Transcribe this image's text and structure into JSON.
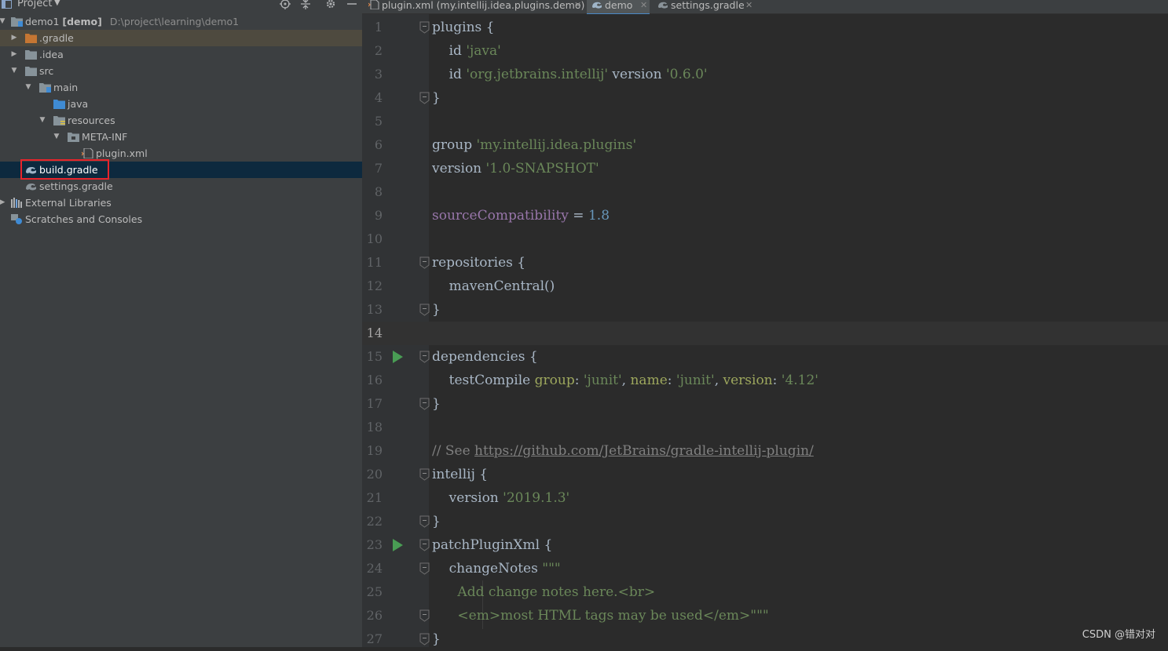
{
  "panel": {
    "title": "Project",
    "tools": [
      "locate-icon",
      "collapse-all-icon",
      "settings-icon",
      "hide-icon"
    ]
  },
  "tree": [
    {
      "label": "demo1",
      "bold": "[demo]",
      "path": "D:\\project\\learning\\demo1",
      "icon": "module-folder-icon",
      "expanded": true
    },
    {
      "label": ".gradle",
      "icon": "folder-orange-icon",
      "expanded": false
    },
    {
      "label": ".idea",
      "icon": "folder-icon",
      "expanded": false
    },
    {
      "label": "src",
      "icon": "folder-icon",
      "expanded": true
    },
    {
      "label": "main",
      "icon": "folder-icon",
      "expanded": true
    },
    {
      "label": "java",
      "icon": "source-folder-icon"
    },
    {
      "label": "resources",
      "icon": "resources-folder-icon",
      "expanded": true
    },
    {
      "label": "META-INF",
      "icon": "folder-icon",
      "expanded": true
    },
    {
      "label": "plugin.xml",
      "icon": "xml-file-icon"
    },
    {
      "label": "build.gradle",
      "icon": "gradle-icon",
      "selected": true
    },
    {
      "label": "settings.gradle",
      "icon": "gradle-icon"
    },
    {
      "label": "External Libraries",
      "icon": "libraries-icon",
      "expanded": false
    },
    {
      "label": "Scratches and Consoles",
      "icon": "scratches-icon"
    }
  ],
  "tabs": [
    {
      "label": "plugin.xml (my.intellij.idea.plugins.demo)",
      "icon": "xml-file-icon",
      "active": false
    },
    {
      "label": "demo",
      "icon": "gradle-icon",
      "active": true
    },
    {
      "label": "settings.gradle",
      "icon": "gradle-icon",
      "active": false
    }
  ],
  "editor": {
    "current_line": 14,
    "line_numbers": [
      "1",
      "2",
      "3",
      "4",
      "5",
      "6",
      "7",
      "8",
      "9",
      "10",
      "11",
      "12",
      "13",
      "14",
      "15",
      "16",
      "17",
      "18",
      "19",
      "20",
      "21",
      "22",
      "23",
      "24",
      "25",
      "26",
      "27"
    ],
    "lines": [
      [
        {
          "t": "plugins {"
        }
      ],
      [
        {
          "t": "    id "
        },
        {
          "t": "'java'",
          "c": "str"
        }
      ],
      [
        {
          "t": "    id "
        },
        {
          "t": "'org.jetbrains.intellij'",
          "c": "str"
        },
        {
          "t": " version "
        },
        {
          "t": "'0.6.0'",
          "c": "str"
        }
      ],
      [
        {
          "t": "}"
        }
      ],
      [],
      [
        {
          "t": "group "
        },
        {
          "t": "'my.intellij.idea.plugins'",
          "c": "str"
        }
      ],
      [
        {
          "t": "version "
        },
        {
          "t": "'1.0-SNAPSHOT'",
          "c": "str"
        }
      ],
      [],
      [
        {
          "t": "sourceCompatibility",
          "c": "prop"
        },
        {
          "t": " = "
        },
        {
          "t": "1.8",
          "c": "num-lit"
        }
      ],
      [],
      [
        {
          "t": "repositories {"
        }
      ],
      [
        {
          "t": "    mavenCentral()"
        }
      ],
      [
        {
          "t": "}"
        }
      ],
      [],
      [
        {
          "t": "dependencies {"
        }
      ],
      [
        {
          "t": "    testCompile "
        },
        {
          "t": "group",
          "c": "named"
        },
        {
          "t": ": "
        },
        {
          "t": "'junit'",
          "c": "str"
        },
        {
          "t": ", "
        },
        {
          "t": "name",
          "c": "named"
        },
        {
          "t": ": "
        },
        {
          "t": "'junit'",
          "c": "str"
        },
        {
          "t": ", "
        },
        {
          "t": "version",
          "c": "named"
        },
        {
          "t": ": "
        },
        {
          "t": "'4.12'",
          "c": "str"
        }
      ],
      [
        {
          "t": "}"
        }
      ],
      [],
      [
        {
          "t": "// See ",
          "c": "cmt"
        },
        {
          "t": "https://github.com/JetBrains/gradle-intellij-plugin/",
          "c": "link"
        }
      ],
      [
        {
          "t": "intellij {"
        }
      ],
      [
        {
          "t": "    version "
        },
        {
          "t": "'2019.1.3'",
          "c": "str"
        }
      ],
      [
        {
          "t": "}"
        }
      ],
      [
        {
          "t": "patchPluginXml {"
        }
      ],
      [
        {
          "t": "    changeNotes "
        },
        {
          "t": "\"\"\"",
          "c": "str"
        }
      ],
      [
        {
          "t": "      Add change notes here.<br>",
          "c": "str"
        }
      ],
      [
        {
          "t": "      <em>most HTML tags may be used</em>\"\"\"",
          "c": "str"
        }
      ],
      [
        {
          "t": "}"
        }
      ]
    ],
    "fold_lines": [
      1,
      4,
      11,
      13,
      15,
      17,
      20,
      22,
      23,
      24,
      26,
      27
    ],
    "run_lines": [
      15,
      23
    ]
  },
  "watermark": "CSDN @错对对",
  "colors": {
    "panel_bg": "#3c3f41",
    "editor_bg": "#2b2b2b",
    "gutter_bg": "#313335",
    "selection": "#0d293e",
    "highlight_box": "#e8242b",
    "string": "#6a8759",
    "number": "#6897bb",
    "property": "#9876aa",
    "named_arg": "#9da75d",
    "comment": "#808080",
    "run_green": "#499c54"
  }
}
